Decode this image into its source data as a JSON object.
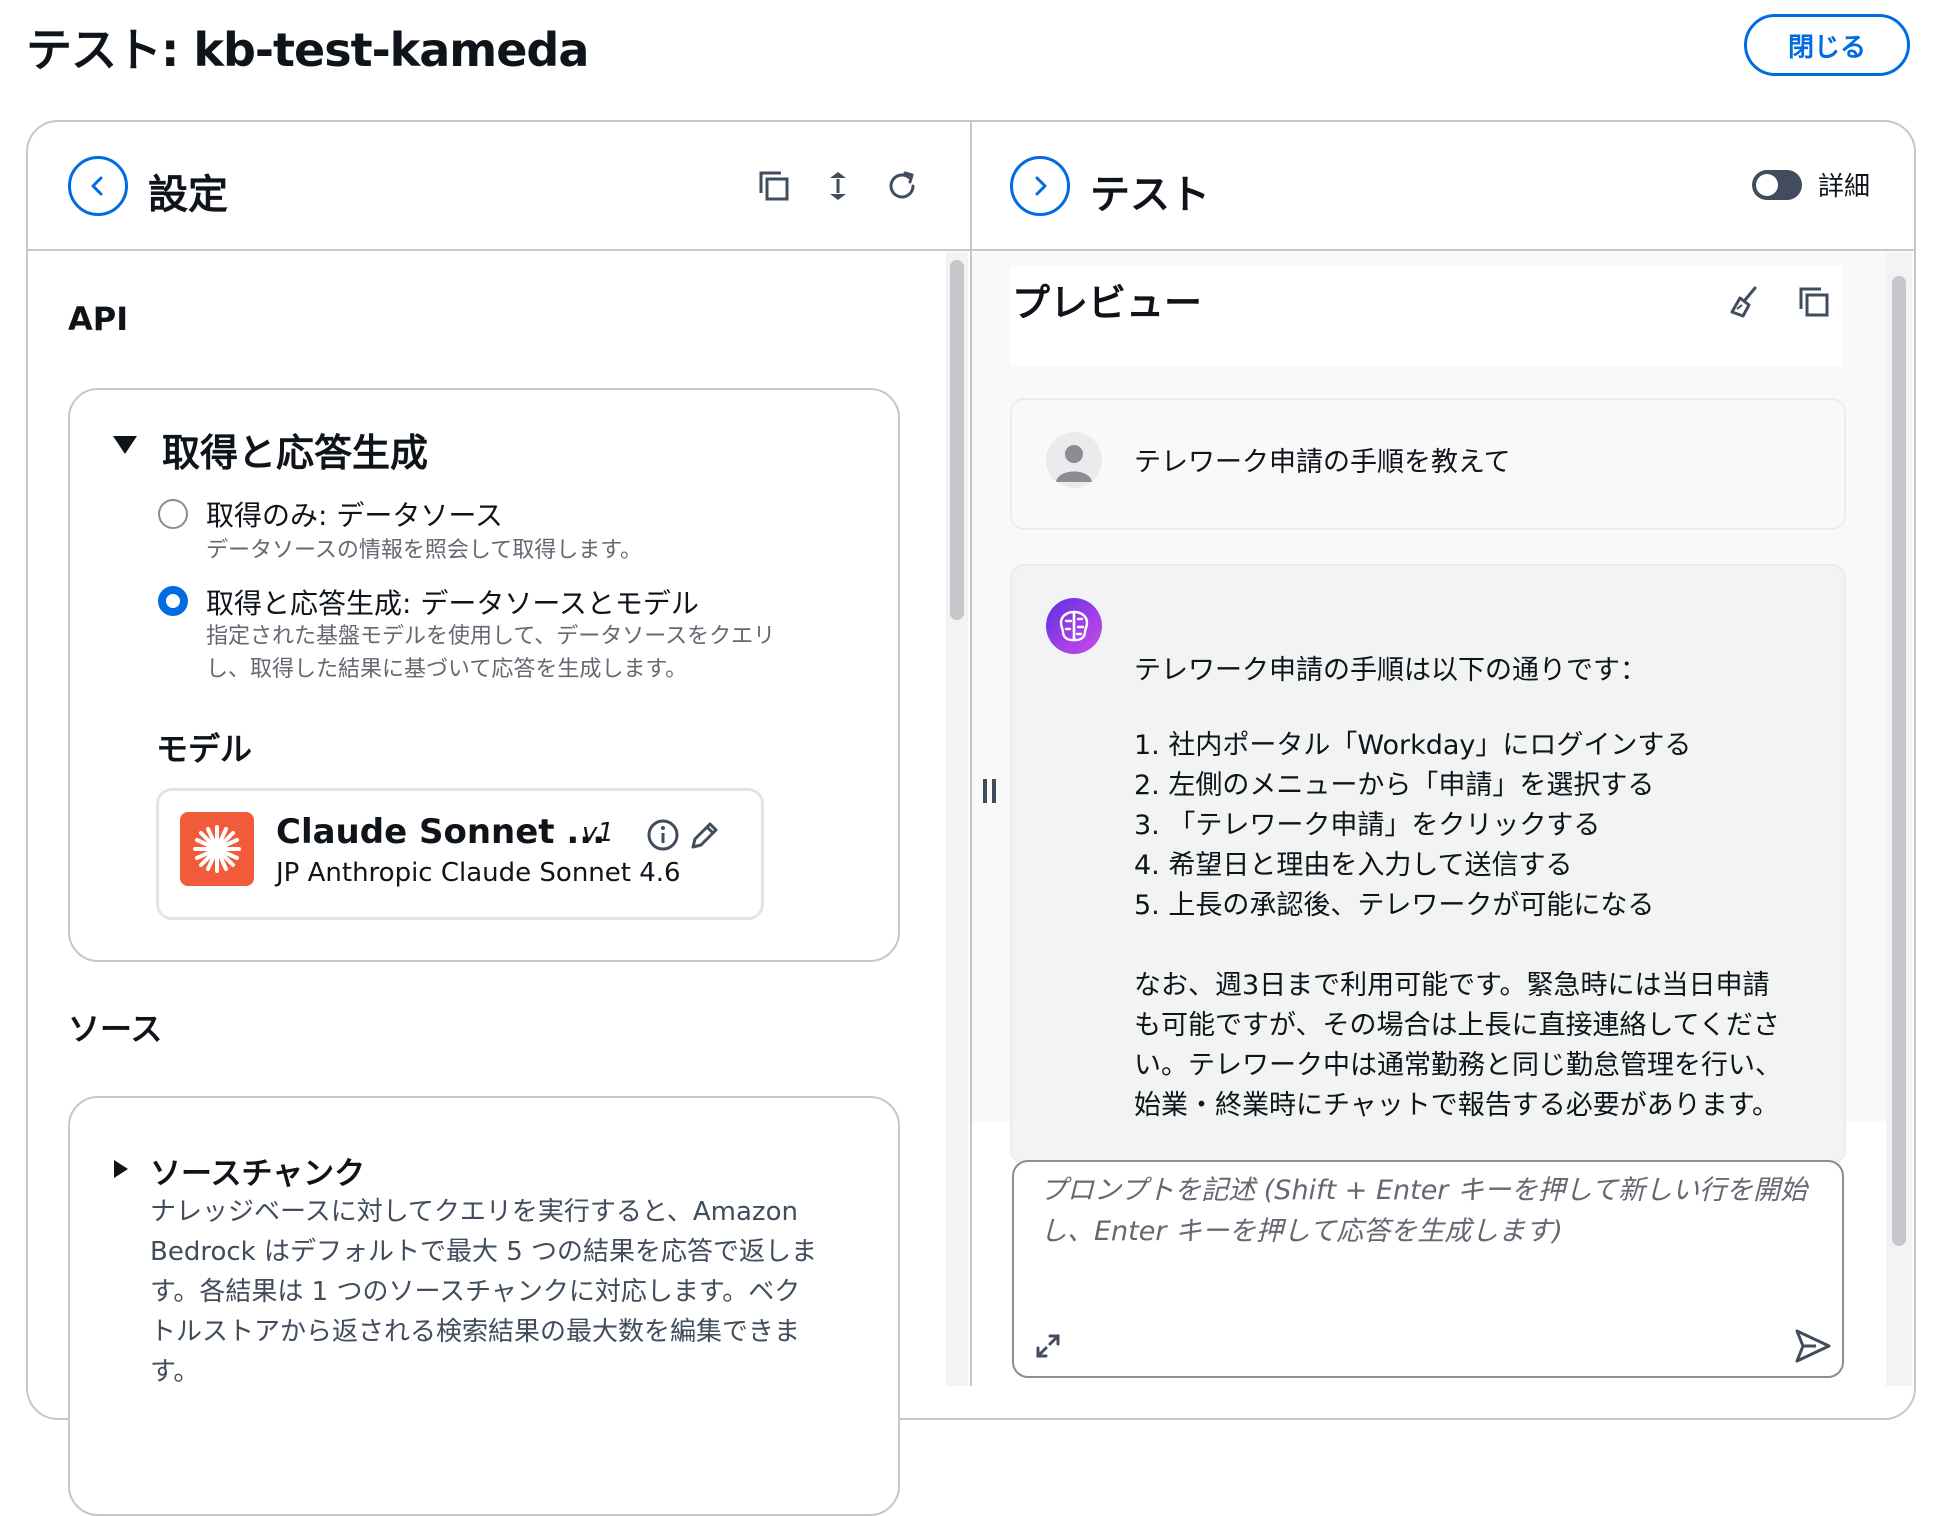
{
  "page": {
    "title": "テスト: kb-test-kameda",
    "close_label": "閉じる"
  },
  "left_panel": {
    "title": "設定",
    "api_section": "API",
    "retrieve_card": {
      "title": "取得と応答生成",
      "options": [
        {
          "label": "取得のみ: データソース",
          "desc": "データソースの情報を照会して取得します。",
          "selected": false
        },
        {
          "label": "取得と応答生成: データソースとモデル",
          "desc_line1": "指定された基盤モデルを使用して、データソースをクエリ",
          "desc_line2": "し、取得した結果に基づいて応答を生成します。",
          "selected": true
        }
      ],
      "model_label": "モデル",
      "model": {
        "name": "Claude Sonnet ...",
        "version": "v1",
        "full_name": "JP Anthropic Claude Sonnet 4.6"
      }
    },
    "source_section": "ソース",
    "source_chunk": {
      "title": "ソースチャンク",
      "desc_lines": [
        "ナレッジベースに対してクエリを実行すると、Amazon",
        "Bedrock はデフォルトで最大 5 つの結果を応答で返しま",
        "す。各結果は 1 つのソースチャンクに対応します。ベク",
        "トルストアから返される検索結果の最大数を編集できま",
        "す。"
      ]
    }
  },
  "right_panel": {
    "title": "テスト",
    "detail_label": "詳細",
    "detail_enabled": false,
    "preview_title": "プレビュー",
    "user_message": "テレワーク申請の手順を教えて",
    "bot_message": {
      "intro": "テレワーク申請の手順は以下の通りです：",
      "steps": [
        "1. 社内ポータル「Workday」にログインする",
        "2. 左側のメニューから「申請」を選択する",
        "3. 「テレワーク申請」をクリックする",
        "4. 希望日と理由を入力して送信する",
        "5. 上長の承認後、テレワークが可能になる"
      ],
      "note_lines": [
        "なお、週3日まで利用可能です。緊急時には当日申請",
        "も可能ですが、その場合は上長に直接連絡してくださ",
        "い。テレワーク中は通常勤務と同じ勤怠管理を行い、",
        "始業・終業時にチャットで報告する必要があります。"
      ]
    },
    "prompt_placeholder": "プロンプトを記述 (Shift + Enter キーを押して新しい行を開始し、Enter キーを押して応答を生成します)"
  },
  "colors": {
    "accent": "#006ce0",
    "border": "#c6c6cd",
    "model_logo": "#f15a3a"
  }
}
